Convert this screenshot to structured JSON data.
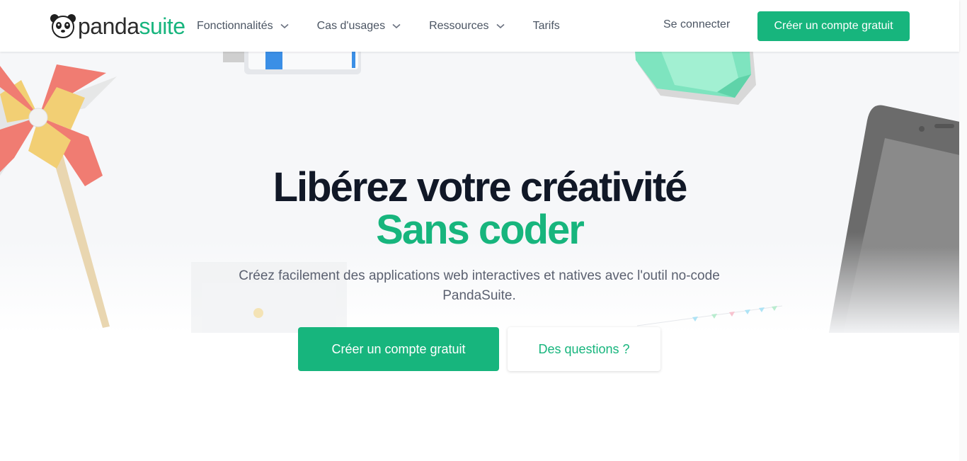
{
  "header": {
    "logo": {
      "text_primary": "panda",
      "text_accent": "suite"
    },
    "nav": [
      {
        "label": "Fonctionnalités",
        "has_dropdown": true
      },
      {
        "label": "Cas d'usages",
        "has_dropdown": true
      },
      {
        "label": "Ressources",
        "has_dropdown": true
      },
      {
        "label": "Tarifs",
        "has_dropdown": false
      }
    ],
    "login_label": "Se connecter",
    "cta_label": "Créer un compte gratuit"
  },
  "hero": {
    "title_line1": "Libérez votre créativité",
    "title_line2": "Sans coder",
    "subtitle": "Créez facilement des applications web interactives et natives avec l'outil no-code PandaSuite.",
    "primary_button": "Créer un compte gratuit",
    "secondary_button": "Des questions ?"
  },
  "icons": {
    "logo": "panda-logo-icon",
    "dropdown": "chevron-down-icon",
    "decorations": [
      "pinwheel-illustration",
      "gem-illustration",
      "phone-illustration",
      "tape-illustration",
      "bunting-illustration",
      "frame-illustration"
    ]
  },
  "colors": {
    "brand": "#17b57d",
    "title": "#111827",
    "text": "#4b5563",
    "hero_bg": "#f6f7f9"
  }
}
